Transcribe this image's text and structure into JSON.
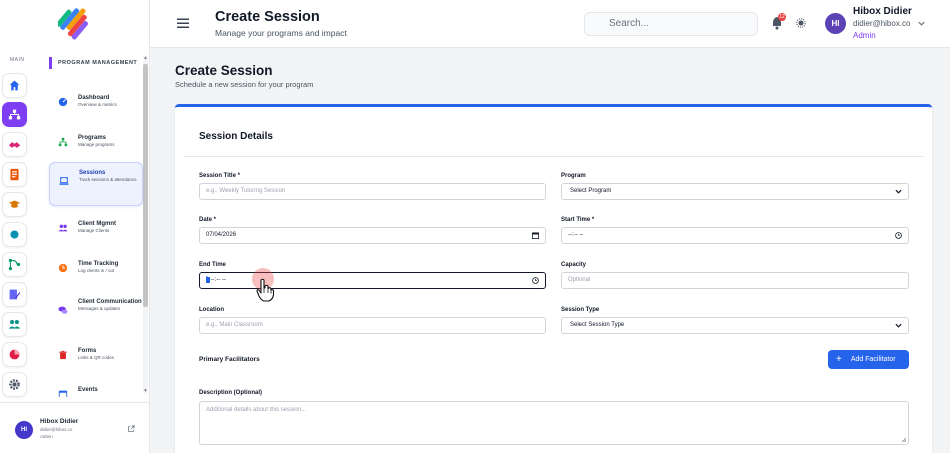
{
  "sidebar": {
    "rail_label": "MAIN",
    "section_header": "PROGRAM MANAGEMENT",
    "rail_icons": [
      "home-icon",
      "sitemap-icon",
      "handshake-icon",
      "document-icon",
      "graduation-icon",
      "circle-icon",
      "flow-icon",
      "edit-doc-icon",
      "users-icon",
      "chart-pie-icon",
      "gear-icon"
    ],
    "items": [
      {
        "title": "Dashboard",
        "subtitle": "Overview & metrics",
        "icon": "dashboard-icon",
        "color": "#2563eb"
      },
      {
        "title": "Programs",
        "subtitle": "Manage programs",
        "icon": "sitemap-icon",
        "color": "#16a34a"
      },
      {
        "title": "Sessions",
        "subtitle": "Track sessions & attendance",
        "icon": "laptop-icon",
        "color": "#2563eb",
        "active": true
      },
      {
        "title": "Client Mgmnt",
        "subtitle": "Manage Clients",
        "icon": "users-icon",
        "color": "#7c3aed"
      },
      {
        "title": "Time Tracking",
        "subtitle": "Log clients in / out",
        "icon": "clock-icon",
        "color": "#f97316"
      },
      {
        "title": "Client Communication",
        "subtitle": "Messages & updates",
        "icon": "comments-icon",
        "color": "#7c3aed"
      },
      {
        "title": "Forms",
        "subtitle": "Links & QR codes",
        "icon": "trash-icon",
        "color": "#dc2626"
      },
      {
        "title": "Events",
        "subtitle": "",
        "icon": "calendar-icon",
        "color": "#2563eb"
      }
    ],
    "footer": {
      "initials": "HI",
      "name": "Hibox Didier",
      "email": "didier@hibox.co",
      "role": "Admin"
    }
  },
  "header": {
    "title": "Create Session",
    "subtitle": "Manage your programs and impact",
    "search_placeholder": "Search...",
    "notification_count": "12",
    "user": {
      "initials": "HI",
      "name": "Hibox Didier",
      "email": "didier@hibox.co",
      "role": "Admin"
    }
  },
  "main": {
    "title": "Create Session",
    "subtitle": "Schedule a new session for your program",
    "card_title": "Session Details",
    "fields": {
      "session_title": {
        "label": "Session Title *",
        "placeholder": "e.g., Weekly Tutoring Session"
      },
      "program": {
        "label": "Program",
        "value": "Select Program"
      },
      "date": {
        "label": "Date *",
        "value": "07/04/2026"
      },
      "start_time": {
        "label": "Start Time *",
        "value": "--:-- --"
      },
      "end_time": {
        "label": "End Time",
        "value": "--:-- --"
      },
      "capacity": {
        "label": "Capacity",
        "placeholder": "Optional"
      },
      "location": {
        "label": "Location",
        "placeholder": "e.g., Main Classroom"
      },
      "session_type": {
        "label": "Session Type",
        "value": "Select Session Type"
      },
      "facilitators": {
        "label": "Primary Facilitators",
        "button": "Add Facilitator"
      },
      "description": {
        "label": "Description (Optional)",
        "placeholder": "Additional details about this session..."
      }
    }
  },
  "colors": {
    "accent": "#2563eb",
    "brand": "#7e3ff2",
    "badge": "#ef4444"
  }
}
